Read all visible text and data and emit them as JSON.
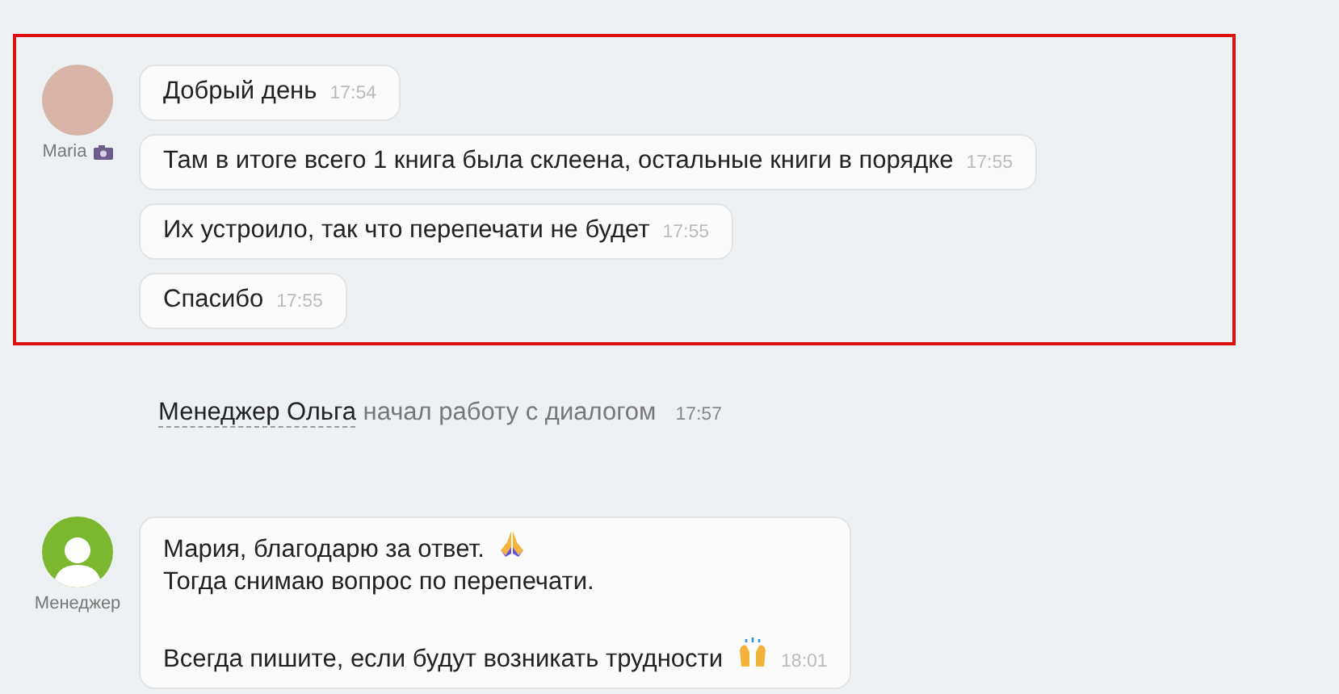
{
  "items": [
    {
      "kind": "group",
      "highlighted": true,
      "sender": "Maria",
      "sender_icon": {
        "kind": "camera"
      },
      "avatar": {
        "kind": "photo"
      },
      "messages": [
        {
          "paragraphs": [
            {
              "lines": [
                {
                  "text": "Добрый день"
                }
              ]
            }
          ],
          "time": "17:54"
        },
        {
          "paragraphs": [
            {
              "lines": [
                {
                  "text": "Там в итоге всего 1 книга была склеена, остальные книги в порядке"
                }
              ]
            }
          ],
          "time": "17:55"
        },
        {
          "paragraphs": [
            {
              "lines": [
                {
                  "text": "Их устроило, так что перепечати не будет"
                }
              ]
            }
          ],
          "time": "17:55"
        },
        {
          "paragraphs": [
            {
              "lines": [
                {
                  "text": "Спасибо"
                }
              ]
            }
          ],
          "time": "17:55"
        }
      ]
    },
    {
      "kind": "event",
      "actor": "Менеджер Ольга",
      "text": "начал работу с диалогом",
      "time": "17:57"
    },
    {
      "kind": "group",
      "highlighted": false,
      "sender": "Менеджер",
      "avatar": {
        "kind": "default"
      },
      "messages": [
        {
          "paragraphs": [
            {
              "lines": [
                {
                  "text": "Мария, благодарю за ответ.",
                  "emoji": {
                    "kind": "pray"
                  }
                },
                {
                  "text": "Тогда снимаю вопрос по перепечати."
                }
              ]
            },
            {
              "lines": [
                {
                  "text": "Всегда пишите, если будут возникать трудности",
                  "emoji": {
                    "kind": "raised-hands"
                  }
                }
              ]
            }
          ],
          "time": "18:01"
        }
      ]
    }
  ]
}
